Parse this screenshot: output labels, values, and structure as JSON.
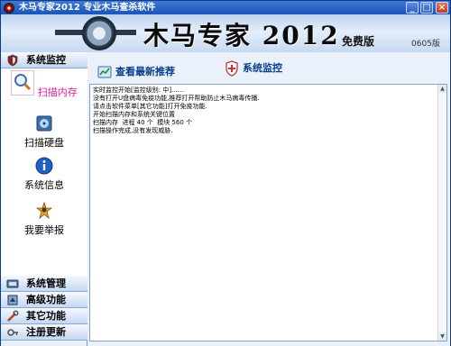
{
  "window": {
    "title": "木马专家2012  专业木马查杀软件",
    "min_label": "_",
    "max_label": "□",
    "close_label": "×"
  },
  "banner": {
    "title": "木马专家 2012",
    "edition": "免费版",
    "build": "0605版"
  },
  "sidebar": {
    "active_section": "系统监控",
    "tools": [
      {
        "label": "扫描内存",
        "icon": "magnifier-icon"
      },
      {
        "label": "扫描硬盘",
        "icon": "disk-icon"
      },
      {
        "label": "系统信息",
        "icon": "info-icon"
      },
      {
        "label": "我要举报",
        "icon": "report-icon"
      }
    ],
    "sections": [
      {
        "label": "系统管理",
        "icon": "system-manage-icon"
      },
      {
        "label": "高级功能",
        "icon": "advanced-icon"
      },
      {
        "label": "其它功能",
        "icon": "tools-icon"
      },
      {
        "label": "注册更新",
        "icon": "register-icon"
      }
    ]
  },
  "main": {
    "link_recommend": "查看最新推荐",
    "link_monitor": "系统监控",
    "log": [
      "实时监控开始[监控级别: 中]......",
      "",
      "没有打开U盘病毒免疫功能,推荐打开帮助防止木马病毒传播.",
      "请点击软件菜单[其它功能]打开免疫功能.",
      "开始扫描内存和系统关键位置",
      "扫描内存  进程 40 个  模块 560 个",
      "扫描操作完成,没有发现威胁."
    ]
  },
  "colors": {
    "titlebar": "#1b54b7",
    "selected_tool": "#e01b9b",
    "link": "#0a3d8f"
  }
}
